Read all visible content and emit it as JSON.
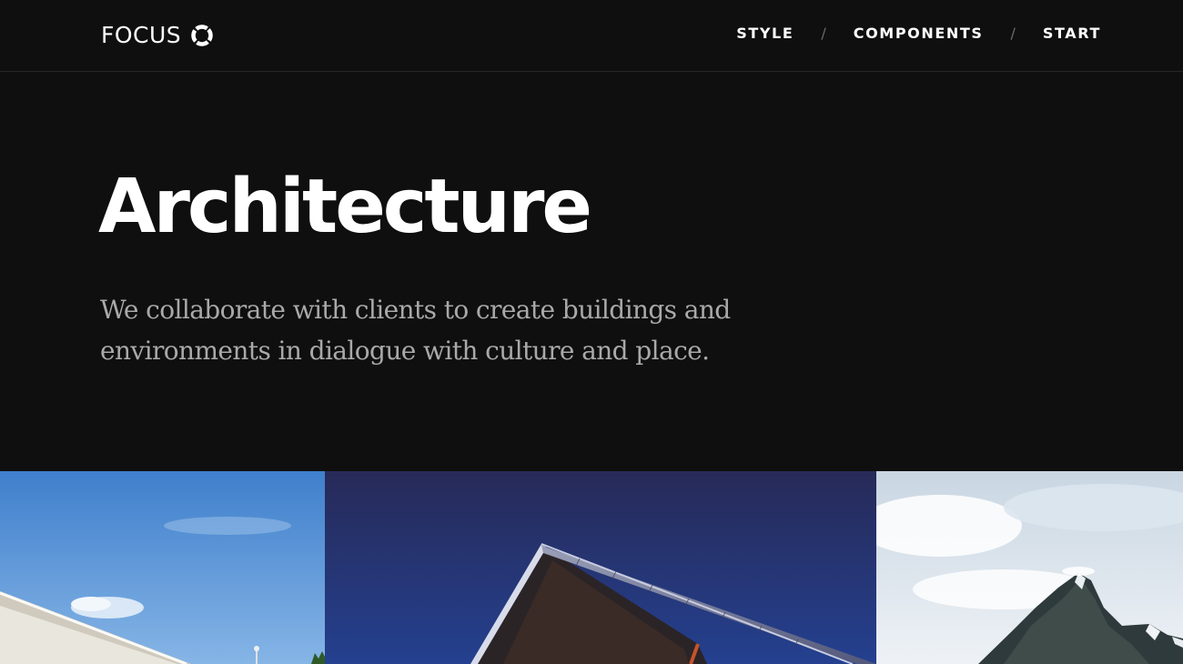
{
  "header": {
    "logo_text": "FOCUS",
    "logo_icon": "ring-icon",
    "nav": [
      {
        "label": "STYLE"
      },
      {
        "label": "COMPONENTS"
      },
      {
        "label": "START"
      }
    ],
    "separator": "/"
  },
  "hero": {
    "title": "Architecture",
    "lede": "We collaborate with clients to create buildings and environments in dialogue with culture and place."
  },
  "gallery": {
    "images": [
      {
        "subject": "white-building-blue-sky"
      },
      {
        "subject": "cantilevered-building-night-sky"
      },
      {
        "subject": "mountain-peak-clouds"
      }
    ]
  },
  "colors": {
    "background": "#0f0f0f",
    "text": "#ffffff",
    "lede": "#a9a9a9",
    "separator": "#6a6a6a"
  }
}
